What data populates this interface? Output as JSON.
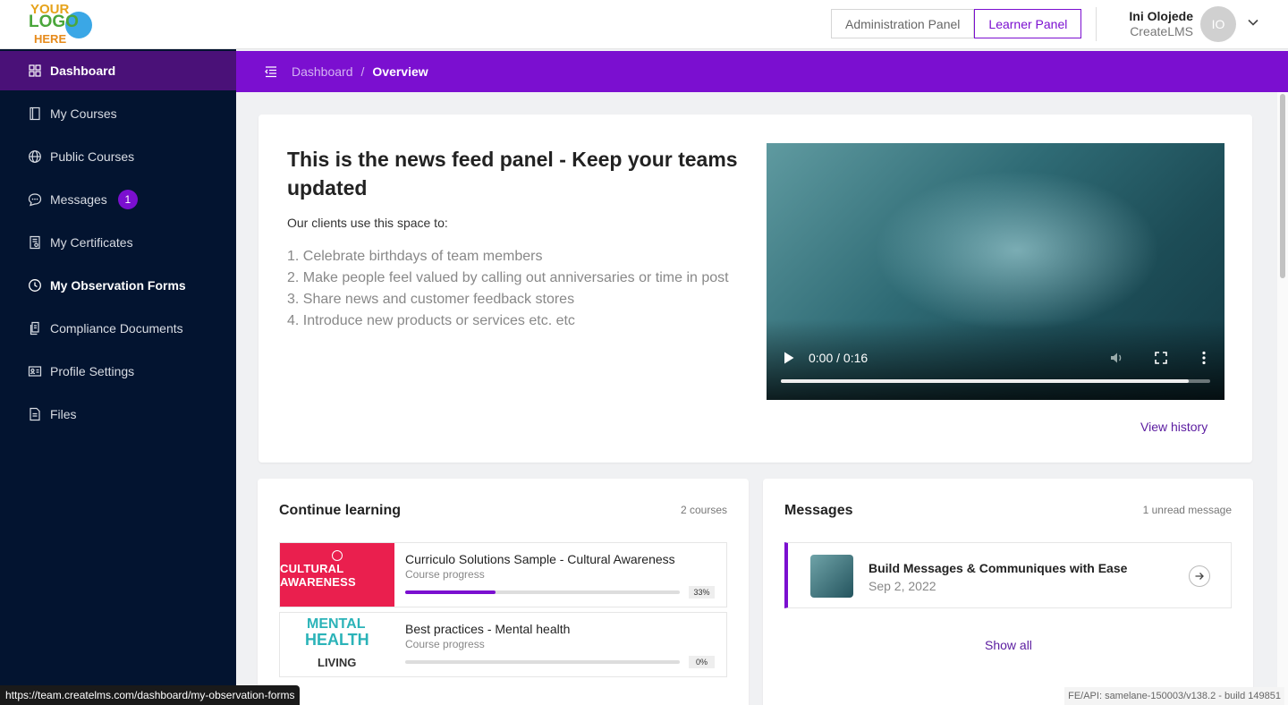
{
  "logo": {
    "line1": "YOUR",
    "line2": "LOGO",
    "line3": "HERE"
  },
  "header": {
    "admin_panel": "Administration Panel",
    "learner_panel": "Learner Panel",
    "user_name": "Ini Olojede",
    "user_org": "CreateLMS",
    "avatar_initials": "IO"
  },
  "sidebar": {
    "items": [
      {
        "label": "Dashboard",
        "icon": "grid-icon"
      },
      {
        "label": "My Courses",
        "icon": "book-icon"
      },
      {
        "label": "Public Courses",
        "icon": "globe-icon"
      },
      {
        "label": "Messages",
        "icon": "chat-icon",
        "badge": "1"
      },
      {
        "label": "My Certificates",
        "icon": "certificate-icon"
      },
      {
        "label": "My Observation Forms",
        "icon": "clock-icon"
      },
      {
        "label": "Compliance Documents",
        "icon": "documents-icon"
      },
      {
        "label": "Profile Settings",
        "icon": "id-card-icon"
      },
      {
        "label": "Files",
        "icon": "file-icon"
      }
    ]
  },
  "breadcrumb": {
    "parent": "Dashboard",
    "separator": "/",
    "current": "Overview"
  },
  "news": {
    "title": "This is the news feed panel - Keep your teams updated",
    "intro": "Our clients use this space to:",
    "list": [
      "1.  Celebrate birthdays of team members",
      "2.  Make people feel valued by calling out anniversaries or time in post",
      "3.  Share news and customer feedback stores",
      "4.  Introduce new products or services etc. etc"
    ],
    "video_time": "0:00 / 0:16",
    "video_progress": 0.95,
    "view_history": "View history"
  },
  "learning": {
    "title": "Continue learning",
    "meta": "2 courses",
    "courses": [
      {
        "title": "Curriculo Solutions Sample - Cultural Awareness",
        "sub": "Course progress",
        "progress": 0.33,
        "pct": "33%",
        "thumb_text": "CULTURAL AWARENESS"
      },
      {
        "title": "Best practices - Mental health",
        "sub": "Course progress",
        "progress": 0,
        "pct": "0%",
        "thumb_line1": "MENTAL",
        "thumb_line2": "HEALTH",
        "thumb_line3": "LIVING"
      }
    ]
  },
  "messages": {
    "title": "Messages",
    "meta": "1 unread message",
    "item": {
      "title": "Build Messages & Communiques with Ease",
      "date": "Sep 2, 2022"
    },
    "show_all": "Show all"
  },
  "status": {
    "url": "https://team.createlms.com/dashboard/my-observation-forms",
    "build": "FE/API: samelane-150003/v138.2 - build 149851"
  },
  "colors": {
    "accent": "#7b0fd0",
    "sidebar_bg": "#031430",
    "sidebar_active": "#4a1178"
  }
}
